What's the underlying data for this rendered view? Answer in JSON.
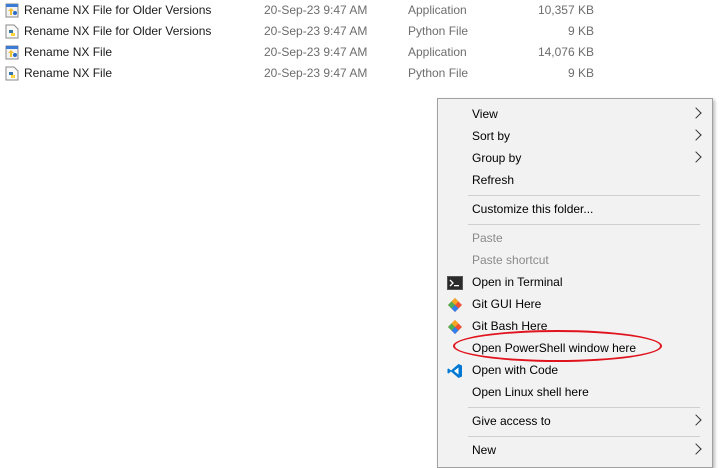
{
  "files": [
    {
      "name": "Rename NX File for Older Versions",
      "date": "20-Sep-23 9:47 AM",
      "type": "Application",
      "size": "10,357 KB",
      "icon": "application-icon"
    },
    {
      "name": "Rename NX File for Older Versions",
      "date": "20-Sep-23 9:47 AM",
      "type": "Python File",
      "size": "9 KB",
      "icon": "python-file-icon"
    },
    {
      "name": "Rename NX File",
      "date": "20-Sep-23 9:47 AM",
      "type": "Application",
      "size": "14,076 KB",
      "icon": "application-icon"
    },
    {
      "name": "Rename NX File",
      "date": "20-Sep-23 9:47 AM",
      "type": "Python File",
      "size": "9 KB",
      "icon": "python-file-icon"
    }
  ],
  "context_menu": {
    "items": [
      {
        "label": "View",
        "submenu": true
      },
      {
        "label": "Sort by",
        "submenu": true
      },
      {
        "label": "Group by",
        "submenu": true
      },
      {
        "label": "Refresh"
      },
      {
        "label": "Customize this folder..."
      },
      {
        "label": "Paste",
        "disabled": true
      },
      {
        "label": "Paste shortcut",
        "disabled": true
      },
      {
        "label": "Open in Terminal",
        "icon": "terminal-icon"
      },
      {
        "label": "Git GUI Here",
        "icon": "git-icon"
      },
      {
        "label": "Git Bash Here",
        "icon": "git-icon"
      },
      {
        "label": "Open PowerShell window here"
      },
      {
        "label": "Open with Code",
        "icon": "vscode-icon"
      },
      {
        "label": "Open Linux shell here"
      },
      {
        "label": "Give access to",
        "submenu": true
      },
      {
        "label": "New",
        "submenu": true
      }
    ]
  },
  "colors": {
    "highlight_ellipse": "#e0141e",
    "menu_background": "#f2f2f2",
    "muted_text": "#6d6d6d"
  }
}
